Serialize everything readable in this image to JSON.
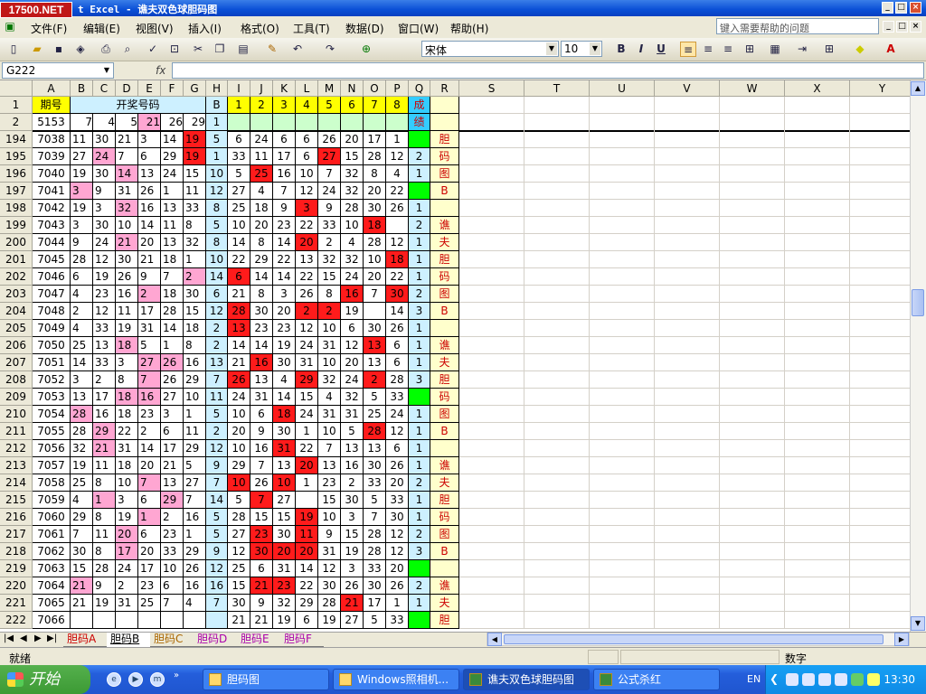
{
  "window": {
    "logo": "17500.NET",
    "title": "t Excel - 谯夫双色球胆码图"
  },
  "menu": [
    "文件(F)",
    "编辑(E)",
    "视图(V)",
    "插入(I)",
    "格式(O)",
    "工具(T)",
    "数据(D)",
    "窗口(W)",
    "帮助(H)"
  ],
  "help_placeholder": "键入需要帮助的问题",
  "format": {
    "font": "宋体",
    "size": "10",
    "bold": "B",
    "italic": "I",
    "underline": "U"
  },
  "name_box": "G222",
  "fx": "fx",
  "columns": [
    "A",
    "B",
    "C",
    "D",
    "E",
    "F",
    "G",
    "H",
    "I",
    "J",
    "K",
    "L",
    "M",
    "N",
    "O",
    "P",
    "Q",
    "R",
    "S",
    "T",
    "U",
    "V",
    "W",
    "X",
    "Y"
  ],
  "header_row1": {
    "row": "1",
    "A": "期号",
    "B_G": "开奖号码",
    "H": "B",
    "I_P": [
      "1",
      "2",
      "3",
      "4",
      "5",
      "6",
      "7",
      "8"
    ],
    "Q": "成"
  },
  "header_row2": {
    "row": "2",
    "A": "5153",
    "B_G": [
      "7",
      "4",
      "5",
      "21",
      "26",
      "29"
    ],
    "H": "1",
    "Q": "绩"
  },
  "rows": [
    [
      "194",
      "7038",
      "11",
      "30",
      "21",
      "3",
      "14",
      "19",
      "5",
      "6",
      "24",
      "6",
      "6",
      "26",
      "20",
      "17",
      "1",
      ""
    ],
    [
      "195",
      "7039",
      "27",
      "24",
      "7",
      "6",
      "29",
      "19",
      "1",
      "33",
      "11",
      "17",
      "6",
      "27",
      "15",
      "28",
      "12",
      "2"
    ],
    [
      "196",
      "7040",
      "19",
      "30",
      "14",
      "13",
      "24",
      "15",
      "10",
      "5",
      "25",
      "16",
      "10",
      "7",
      "32",
      "8",
      "4",
      "1"
    ],
    [
      "197",
      "7041",
      "3",
      "9",
      "31",
      "26",
      "1",
      "11",
      "12",
      "27",
      "4",
      "7",
      "12",
      "24",
      "32",
      "20",
      "22",
      ""
    ],
    [
      "198",
      "7042",
      "19",
      "3",
      "32",
      "16",
      "13",
      "33",
      "8",
      "25",
      "18",
      "9",
      "3",
      "9",
      "28",
      "30",
      "26",
      "1"
    ],
    [
      "199",
      "7043",
      "3",
      "30",
      "10",
      "14",
      "11",
      "8",
      "5",
      "10",
      "20",
      "23",
      "22",
      "33",
      "10",
      "18",
      "",
      "2"
    ],
    [
      "200",
      "7044",
      "9",
      "24",
      "21",
      "20",
      "13",
      "32",
      "8",
      "14",
      "8",
      "14",
      "20",
      "2",
      "4",
      "28",
      "12",
      "1"
    ],
    [
      "201",
      "7045",
      "28",
      "12",
      "30",
      "21",
      "18",
      "1",
      "10",
      "22",
      "29",
      "22",
      "13",
      "32",
      "32",
      "10",
      "18",
      "1"
    ],
    [
      "202",
      "7046",
      "6",
      "19",
      "26",
      "9",
      "7",
      "2",
      "14",
      "6",
      "14",
      "14",
      "22",
      "15",
      "24",
      "20",
      "22",
      "1"
    ],
    [
      "203",
      "7047",
      "4",
      "23",
      "16",
      "2",
      "18",
      "30",
      "6",
      "21",
      "8",
      "3",
      "26",
      "8",
      "16",
      "7",
      "30",
      "2"
    ],
    [
      "204",
      "7048",
      "2",
      "12",
      "11",
      "17",
      "28",
      "15",
      "12",
      "28",
      "30",
      "20",
      "2",
      "2",
      "19",
      "",
      "14",
      "3"
    ],
    [
      "205",
      "7049",
      "4",
      "33",
      "19",
      "31",
      "14",
      "18",
      "2",
      "13",
      "23",
      "23",
      "12",
      "10",
      "6",
      "30",
      "26",
      "1"
    ],
    [
      "206",
      "7050",
      "25",
      "13",
      "18",
      "5",
      "1",
      "8",
      "2",
      "14",
      "14",
      "19",
      "24",
      "31",
      "12",
      "13",
      "6",
      "1"
    ],
    [
      "207",
      "7051",
      "14",
      "33",
      "3",
      "27",
      "26",
      "16",
      "13",
      "21",
      "16",
      "30",
      "31",
      "10",
      "20",
      "13",
      "6",
      "1"
    ],
    [
      "208",
      "7052",
      "3",
      "2",
      "8",
      "7",
      "26",
      "29",
      "7",
      "26",
      "13",
      "4",
      "29",
      "32",
      "24",
      "2",
      "28",
      "3"
    ],
    [
      "209",
      "7053",
      "13",
      "17",
      "18",
      "16",
      "27",
      "10",
      "11",
      "24",
      "31",
      "14",
      "15",
      "4",
      "32",
      "5",
      "33",
      ""
    ],
    [
      "210",
      "7054",
      "28",
      "16",
      "18",
      "23",
      "3",
      "1",
      "5",
      "10",
      "6",
      "18",
      "24",
      "31",
      "31",
      "25",
      "24",
      "1"
    ],
    [
      "211",
      "7055",
      "28",
      "29",
      "22",
      "2",
      "6",
      "11",
      "2",
      "20",
      "9",
      "30",
      "1",
      "10",
      "5",
      "28",
      "12",
      "1"
    ],
    [
      "212",
      "7056",
      "32",
      "21",
      "31",
      "14",
      "17",
      "29",
      "12",
      "10",
      "16",
      "31",
      "22",
      "7",
      "13",
      "13",
      "6",
      "1"
    ],
    [
      "213",
      "7057",
      "19",
      "11",
      "18",
      "20",
      "21",
      "5",
      "9",
      "29",
      "7",
      "13",
      "20",
      "13",
      "16",
      "30",
      "26",
      "1"
    ],
    [
      "214",
      "7058",
      "25",
      "8",
      "10",
      "7",
      "13",
      "27",
      "7",
      "10",
      "26",
      "10",
      "1",
      "23",
      "2",
      "33",
      "20",
      "2"
    ],
    [
      "215",
      "7059",
      "4",
      "1",
      "3",
      "6",
      "29",
      "7",
      "14",
      "5",
      "7",
      "27",
      "",
      "15",
      "30",
      "5",
      "33",
      "1"
    ],
    [
      "216",
      "7060",
      "29",
      "8",
      "19",
      "1",
      "2",
      "16",
      "5",
      "28",
      "15",
      "15",
      "19",
      "10",
      "3",
      "7",
      "30",
      "1"
    ],
    [
      "217",
      "7061",
      "7",
      "11",
      "20",
      "6",
      "23",
      "1",
      "5",
      "27",
      "23",
      "30",
      "11",
      "9",
      "15",
      "28",
      "12",
      "2"
    ],
    [
      "218",
      "7062",
      "30",
      "8",
      "17",
      "20",
      "33",
      "29",
      "9",
      "12",
      "30",
      "20",
      "20",
      "31",
      "19",
      "28",
      "12",
      "3"
    ],
    [
      "219",
      "7063",
      "15",
      "28",
      "24",
      "17",
      "10",
      "26",
      "12",
      "25",
      "6",
      "31",
      "14",
      "12",
      "3",
      "33",
      "20",
      ""
    ],
    [
      "220",
      "7064",
      "21",
      "9",
      "2",
      "23",
      "6",
      "16",
      "16",
      "15",
      "21",
      "23",
      "22",
      "30",
      "26",
      "30",
      "26",
      "2"
    ],
    [
      "221",
      "7065",
      "21",
      "19",
      "31",
      "25",
      "7",
      "4",
      "7",
      "30",
      "9",
      "32",
      "29",
      "28",
      "21",
      "17",
      "1",
      "1"
    ],
    [
      "222",
      "7066",
      "",
      "",
      "",
      "",
      "",
      "",
      "",
      "21",
      "21",
      "19",
      "6",
      "19",
      "27",
      "5",
      "33",
      ""
    ]
  ],
  "r_labels": {
    "194": "胆",
    "195": "码",
    "196": "图",
    "197": "B",
    "199": "谯",
    "200": "夫",
    "201": "胆",
    "202": "码",
    "203": "图",
    "204": "B",
    "206": "谯",
    "207": "夫",
    "208": "胆",
    "209": "码",
    "210": "图",
    "211": "B",
    "213": "谯",
    "214": "夫",
    "215": "胆",
    "216": "码",
    "217": "图",
    "218": "B",
    "220": "谯",
    "221": "夫",
    "222": "胆"
  },
  "highlights_pink": [
    "195.C",
    "196.D",
    "197.B",
    "198.D",
    "200.D",
    "202.G",
    "203.E",
    "206.D",
    "207.E",
    "207.F",
    "208.E",
    "209.D",
    "209.E",
    "210.B",
    "211.C",
    "212.C",
    "214.E",
    "215.C",
    "215.F",
    "216.E",
    "217.D",
    "218.D",
    "220.B"
  ],
  "highlights_red": [
    "194.G",
    "195.G",
    "195.M",
    "196.J",
    "198.L",
    "199.O",
    "200.L",
    "201.P",
    "202.I",
    "203.N",
    "203.P",
    "204.I",
    "204.L",
    "204.M",
    "205.I",
    "206.O",
    "207.J",
    "208.I",
    "208.L",
    "208.O",
    "210.K",
    "211.O",
    "212.K",
    "213.L",
    "214.I",
    "214.K",
    "215.J",
    "216.L",
    "217.J",
    "217.L",
    "218.J",
    "218.K",
    "218.L",
    "220.J",
    "220.K",
    "221.N"
  ],
  "green_q": [
    "194",
    "197",
    "209",
    "219",
    "222"
  ],
  "sheet_tabs": [
    "胆码A",
    "胆码B",
    "胆码C",
    "胆码D",
    "胆码E",
    "胆码F"
  ],
  "status": {
    "ready": "就绪",
    "mode": "数字"
  },
  "taskbar": {
    "start": "开始",
    "tasks": [
      "胆码图",
      "Windows照相机...",
      "谯夫双色球胆码图",
      "公式杀红"
    ],
    "lang": "EN",
    "clock": "13:30"
  },
  "colors": {
    "pink": "#ffa6d2",
    "red": "#ff1b1b",
    "green": "#00ff00",
    "yellow": "#ffff00",
    "cyan": "#cdf0ff",
    "lightgreen": "#ccffcc",
    "rcol": "#ffffcc"
  }
}
